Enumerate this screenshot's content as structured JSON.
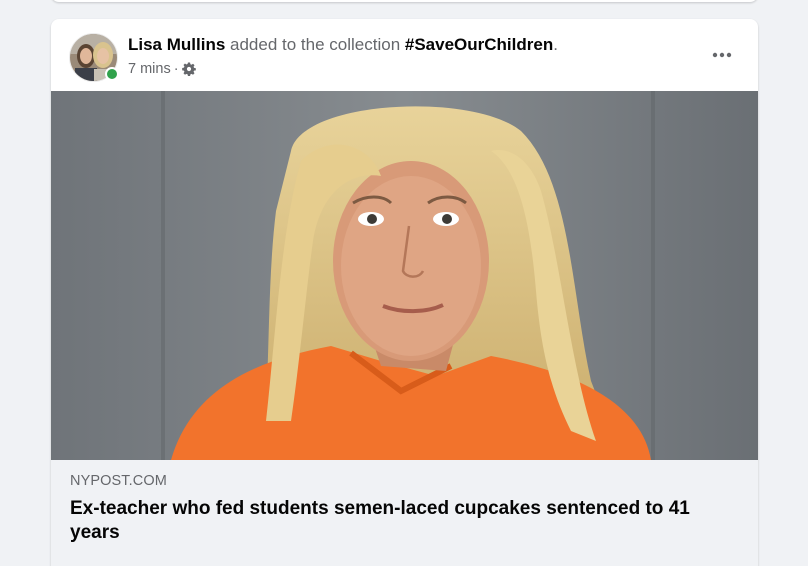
{
  "post": {
    "author": "Lisa Mullins",
    "action_text": " added to the collection ",
    "collection": "#SaveOurChildren",
    "period": ".",
    "timestamp": "7 mins",
    "separator": "·",
    "privacy_icon": "gear-icon",
    "more_icon": "more-horizontal-icon",
    "presence_status": "online"
  },
  "link_preview": {
    "domain": "NYPOST.COM",
    "title": "Ex-teacher who fed students semen-laced cupcakes sentenced to 41 years"
  },
  "colors": {
    "page_background": "#f0f2f5",
    "card_background": "#ffffff",
    "primary_text": "#050505",
    "secondary_text": "#65676b",
    "presence_green": "#31a24c",
    "shirt_orange": "#f2732c"
  }
}
